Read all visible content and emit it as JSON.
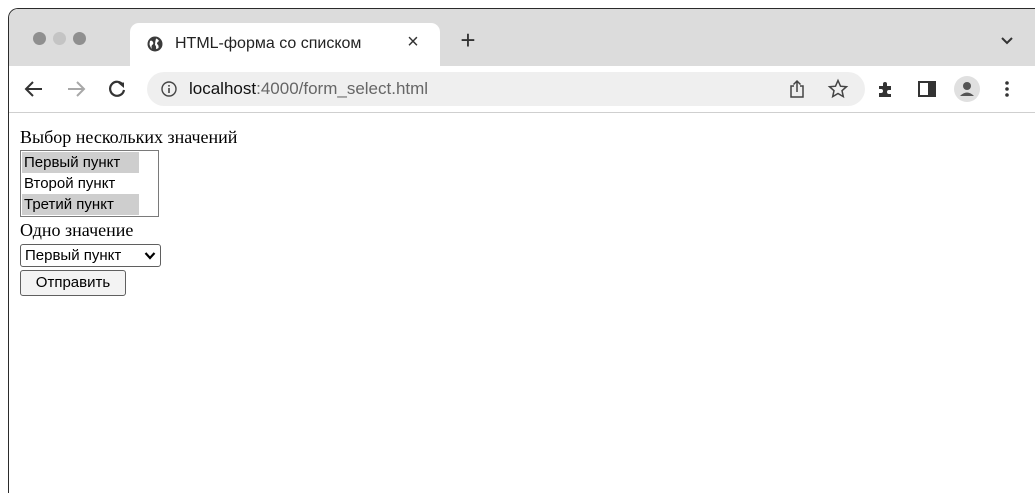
{
  "browser": {
    "tab": {
      "title": "HTML-форма со списком",
      "close_icon": "close-icon",
      "favicon": "globe-icon"
    },
    "new_tab_icon": "plus-icon",
    "address_bar": {
      "host": "localhost",
      "path": ":4000/form_select.html"
    },
    "toolbar_icons": [
      "back-icon",
      "forward-icon",
      "reload-icon",
      "info-icon",
      "share-icon",
      "star-icon",
      "extensions-icon",
      "side-panel-icon",
      "profile-icon",
      "menu-icon"
    ]
  },
  "form": {
    "multi_label": "Выбор нескольких значений",
    "multi_options": [
      {
        "label": "Первый пункт",
        "selected": true
      },
      {
        "label": "Второй пункт",
        "selected": false
      },
      {
        "label": "Третий пункт",
        "selected": true
      }
    ],
    "single_label": "Одно значение",
    "single_value": "Первый пункт",
    "submit_label": "Отправить"
  }
}
